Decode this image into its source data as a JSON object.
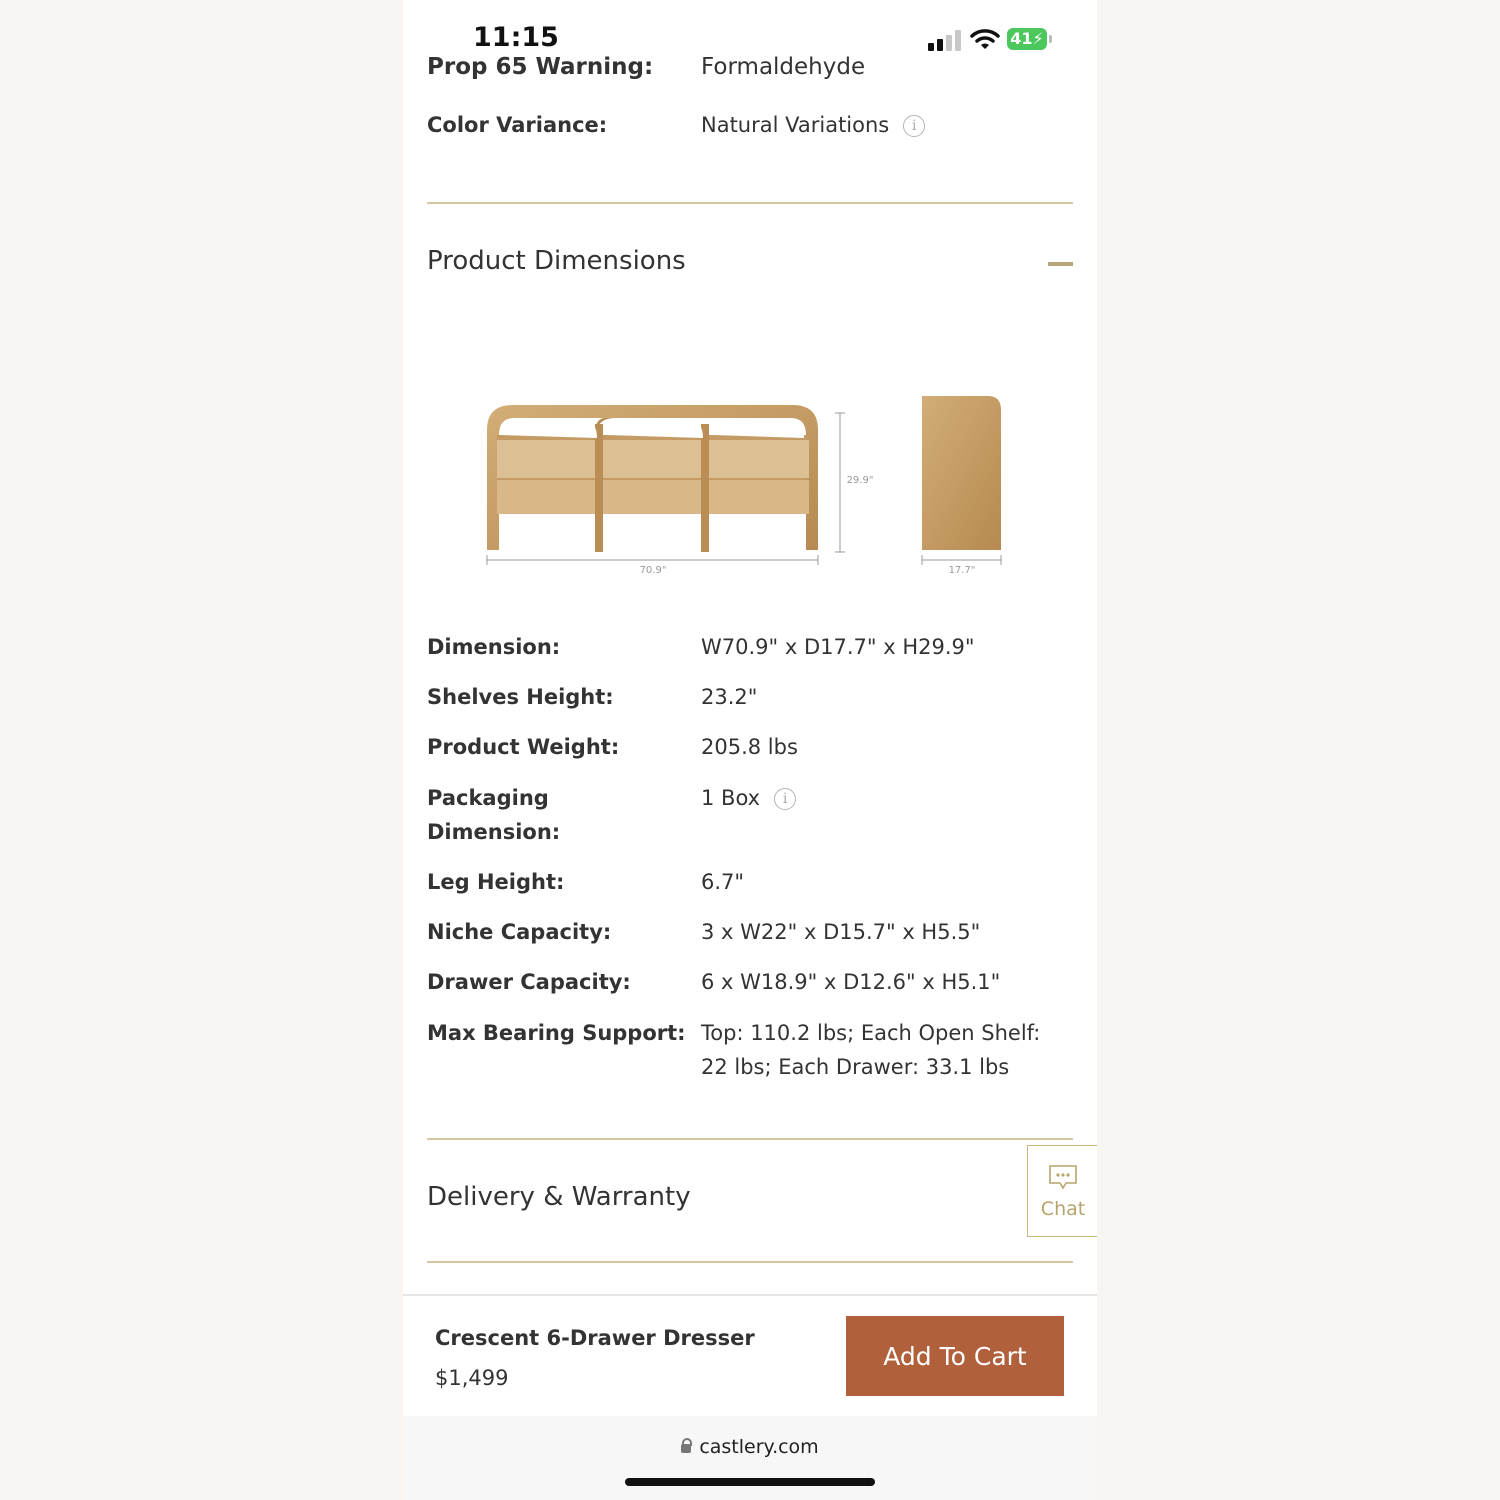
{
  "status": {
    "time": "11:15",
    "battery": "41"
  },
  "partial_row": {
    "label": "Prop 65 Warning:",
    "value": "Formaldehyde"
  },
  "color_variance": {
    "label": "Color Variance:",
    "value": "Natural Variations"
  },
  "dimensions_section": {
    "title": "Product Dimensions",
    "diagram": {
      "width": "70.9\"",
      "height": "29.9\"",
      "depth": "17.7\""
    },
    "specs": [
      {
        "label": "Dimension:",
        "value": "W70.9\" x D17.7\" x H29.9\""
      },
      {
        "label": "Shelves Height:",
        "value": "23.2\""
      },
      {
        "label": "Product Weight:",
        "value": "205.8 lbs"
      },
      {
        "label": "Packaging Dimension:",
        "value": "1 Box"
      },
      {
        "label": "Leg Height:",
        "value": "6.7\""
      },
      {
        "label": "Niche Capacity:",
        "value": "3 x W22\" x D15.7\" x H5.5\""
      },
      {
        "label": "Drawer Capacity:",
        "value": "6 x W18.9\" x D12.6\" x H5.1\""
      },
      {
        "label": "Max Bearing Support:",
        "value": "Top: 110.2 lbs; Each Open Shelf: 22 lbs; Each Drawer: 33.1 lbs"
      }
    ]
  },
  "delivery_section": {
    "title": "Delivery & Warranty"
  },
  "chat": {
    "label": "Chat"
  },
  "bottom_bar": {
    "product_name": "Crescent 6-Drawer Dresser",
    "price": "$1,499",
    "cta": "Add To Cart"
  },
  "browser": {
    "url": "castlery.com"
  },
  "colors": {
    "accent": "#b0613c",
    "divider": "#d4c6a1",
    "gold": "#b9a57c"
  }
}
